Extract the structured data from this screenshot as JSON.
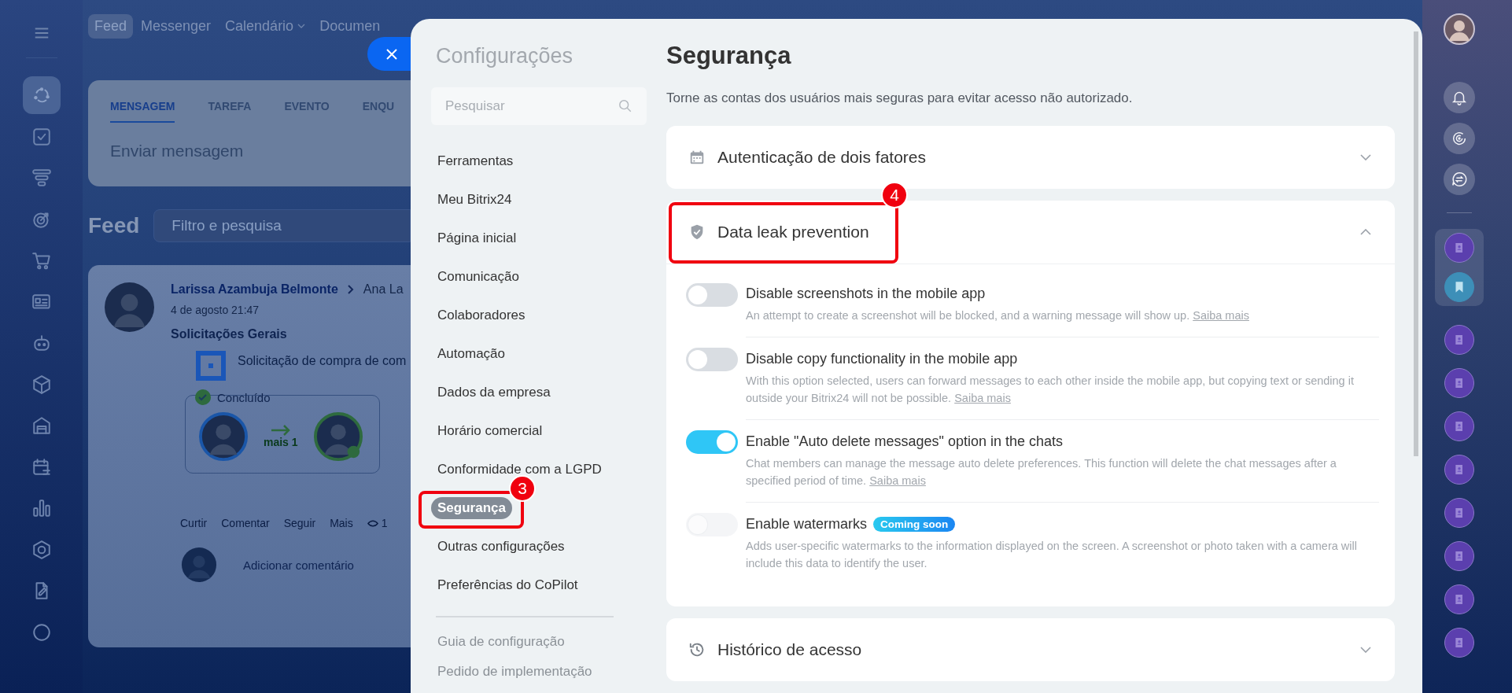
{
  "left_rail": {
    "items": [
      {
        "selected": true
      },
      {
        "selected": false
      },
      {
        "selected": false
      },
      {
        "selected": false
      },
      {
        "selected": false
      },
      {
        "selected": false
      },
      {
        "selected": false
      },
      {
        "selected": false
      },
      {
        "selected": false
      },
      {
        "selected": false
      },
      {
        "selected": false
      },
      {
        "selected": false
      },
      {
        "selected": false
      },
      {
        "selected": false
      }
    ]
  },
  "top_nav": [
    {
      "label": "Feed",
      "selected": true,
      "dropdown": false
    },
    {
      "label": "Messenger",
      "selected": false,
      "dropdown": false
    },
    {
      "label": "Calendário",
      "selected": false,
      "dropdown": true
    },
    {
      "label": "Documen",
      "selected": false,
      "dropdown": false
    }
  ],
  "composer": {
    "tabs": [
      {
        "label": "MENSAGEM",
        "selected": true
      },
      {
        "label": "TAREFA",
        "selected": false
      },
      {
        "label": "EVENTO",
        "selected": false
      },
      {
        "label": "ENQU",
        "selected": false
      }
    ],
    "placeholder": "Enviar mensagem"
  },
  "feed": {
    "title": "Feed",
    "filter_placeholder": "Filtro e pesquisa",
    "post": {
      "author": "Larissa Azambuja Belmonte",
      "recipient": "Ana La",
      "date": "4 de agosto 21:47",
      "title": "Solicitações Gerais",
      "item": "Solicitação de compra de com",
      "status": "Concluído",
      "more": "mais 1",
      "actions": [
        "Curtir",
        "Comentar",
        "Seguir",
        "Mais"
      ],
      "views": "1",
      "comment_placeholder": "Adicionar comentário"
    }
  },
  "settings": {
    "title": "Configurações",
    "search_placeholder": "Pesquisar",
    "nav": [
      {
        "label": "Ferramentas",
        "selected": false
      },
      {
        "label": "Meu Bitrix24",
        "selected": false
      },
      {
        "label": "Página inicial",
        "selected": false
      },
      {
        "label": "Comunicação",
        "selected": false
      },
      {
        "label": "Colaboradores",
        "selected": false
      },
      {
        "label": "Automação",
        "selected": false
      },
      {
        "label": "Dados da empresa",
        "selected": false
      },
      {
        "label": "Horário comercial",
        "selected": false
      },
      {
        "label": "Conformidade com a LGPD",
        "selected": false
      },
      {
        "label": "Segurança",
        "selected": true,
        "callout": "3"
      },
      {
        "label": "Outras configurações",
        "selected": false
      },
      {
        "label": "Preferências do CoPilot",
        "selected": false
      }
    ],
    "footer_links": [
      "Guia de configuração",
      "Pedido de implementação"
    ]
  },
  "page": {
    "title": "Segurança",
    "subtitle": "Torne as contas dos usuários mais seguras para evitar acesso não autorizado.",
    "sections": [
      {
        "kind": "calendar",
        "title": "Autenticação de dois fatores",
        "expanded": false
      },
      {
        "kind": "shield",
        "title": "Data leak prevention",
        "expanded": true,
        "callout": "4",
        "options": [
          {
            "label": "Disable screenshots in the mobile app",
            "on": false,
            "disabled": false,
            "description": "An attempt to create a screenshot will be blocked, and a warning message will show up.",
            "link": "Saiba mais"
          },
          {
            "label": "Disable copy functionality in the mobile app",
            "on": false,
            "disabled": false,
            "description": "With this option selected, users can forward messages to each other inside the mobile app, but copying text or sending it outside your Bitrix24 will not be possible.",
            "link": "Saiba mais"
          },
          {
            "label": "Enable \"Auto delete messages\" option in the chats",
            "on": true,
            "disabled": false,
            "description": "Chat members can manage the message auto delete preferences. This function will delete the chat messages after a specified period of time.",
            "link": "Saiba mais"
          },
          {
            "label": "Enable watermarks",
            "on": false,
            "disabled": true,
            "badge": "Coming soon",
            "description": "Adds user-specific watermarks to the information displayed on the screen. A screenshot or photo taken with a camera will include this data to identify the user."
          }
        ]
      },
      {
        "kind": "history",
        "title": "Histórico de acesso",
        "expanded": false
      }
    ]
  }
}
